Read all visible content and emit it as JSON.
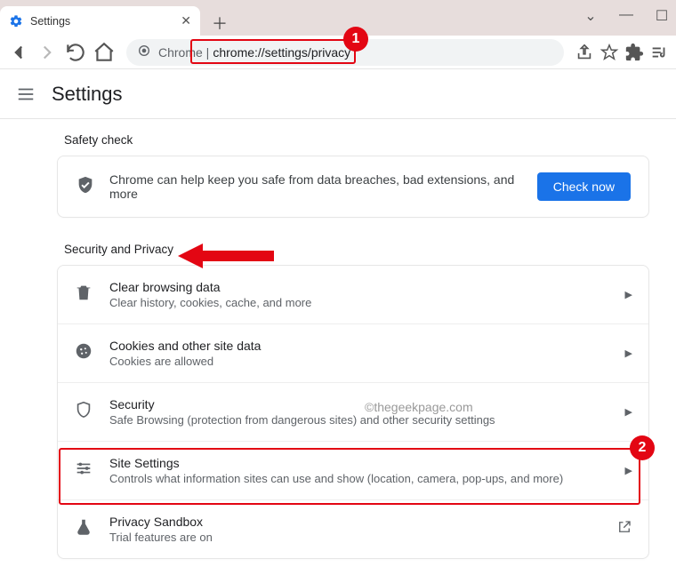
{
  "tab": {
    "title": "Settings"
  },
  "window_controls": {
    "drop": "⌄",
    "min": "—",
    "max": "☐"
  },
  "toolbar": {
    "url_prefix": "Chrome |",
    "url_path": "chrome://settings/privacy"
  },
  "settings_header": "Settings",
  "safety": {
    "section_label": "Safety check",
    "text": "Chrome can help keep you safe from data breaches, bad extensions, and more",
    "button": "Check now"
  },
  "security_section_label": "Security and Privacy",
  "rows": [
    {
      "icon": "trash",
      "title": "Clear browsing data",
      "sub": "Clear history, cookies, cache, and more",
      "action": "chevron"
    },
    {
      "icon": "cookie",
      "title": "Cookies and other site data",
      "sub": "Cookies are allowed",
      "action": "chevron"
    },
    {
      "icon": "shield",
      "title": "Security",
      "sub": "Safe Browsing (protection from dangerous sites) and other security settings",
      "action": "chevron"
    },
    {
      "icon": "sliders",
      "title": "Site Settings",
      "sub": "Controls what information sites can use and show (location, camera, pop-ups, and more)",
      "action": "chevron"
    },
    {
      "icon": "flask",
      "title": "Privacy Sandbox",
      "sub": "Trial features are on",
      "action": "external"
    }
  ],
  "watermark": "©thegeekpage.com",
  "annotations": {
    "badge1": "1",
    "badge2": "2"
  }
}
